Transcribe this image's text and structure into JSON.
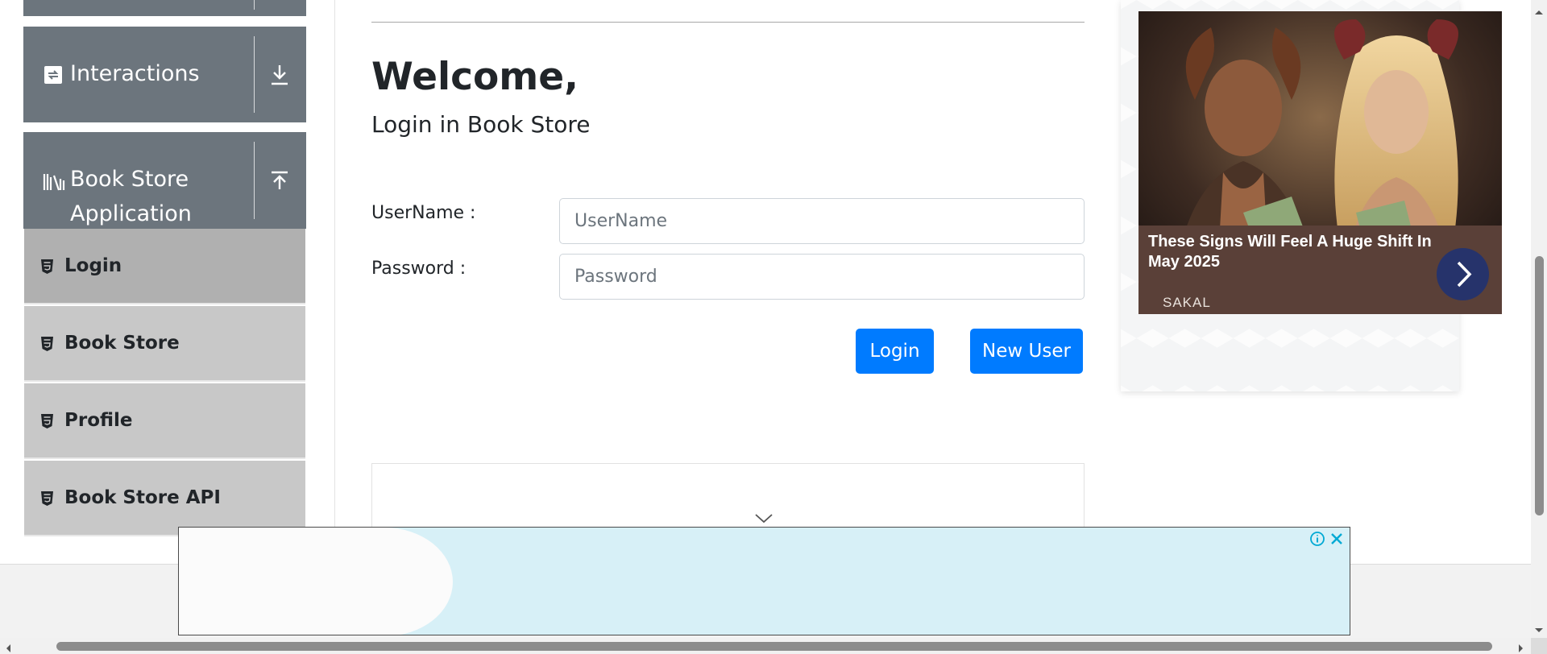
{
  "sidebar": {
    "groups": [
      {
        "label": "",
        "icon": "collapsed-group-icon",
        "toggle_icon": "arrow-down-icon"
      },
      {
        "label": "Interactions",
        "icon": "interactions-icon",
        "toggle_icon": "arrow-down-icon"
      },
      {
        "label": "Book Store Application",
        "label_line1": "Book Store",
        "label_line2": "Application",
        "icon": "books-icon",
        "toggle_icon": "arrow-up-icon"
      }
    ],
    "items": [
      {
        "label": "Login",
        "icon": "html5-icon",
        "active": true
      },
      {
        "label": "Book Store",
        "icon": "html5-icon",
        "active": false
      },
      {
        "label": "Profile",
        "icon": "html5-icon",
        "active": false
      },
      {
        "label": "Book Store API",
        "icon": "html5-icon",
        "active": false
      }
    ]
  },
  "main": {
    "title": "Welcome,",
    "subtitle": "Login in Book Store",
    "username": {
      "label": "UserName :",
      "placeholder": "UserName",
      "value": ""
    },
    "password": {
      "label": "Password :",
      "placeholder": "Password",
      "value": ""
    },
    "buttons": {
      "login": "Login",
      "new_user": "New User"
    }
  },
  "ad": {
    "headline": "These Signs Will Feel A Huge Shift In May 2025",
    "source": "SAKAL",
    "arrow_icon": "chevron-right-icon"
  },
  "colors": {
    "primary": "#007bff",
    "sidebar_header": "#6c757d",
    "sidebar_item": "#c8c8c8",
    "sidebar_item_active": "#b0b0b0"
  }
}
